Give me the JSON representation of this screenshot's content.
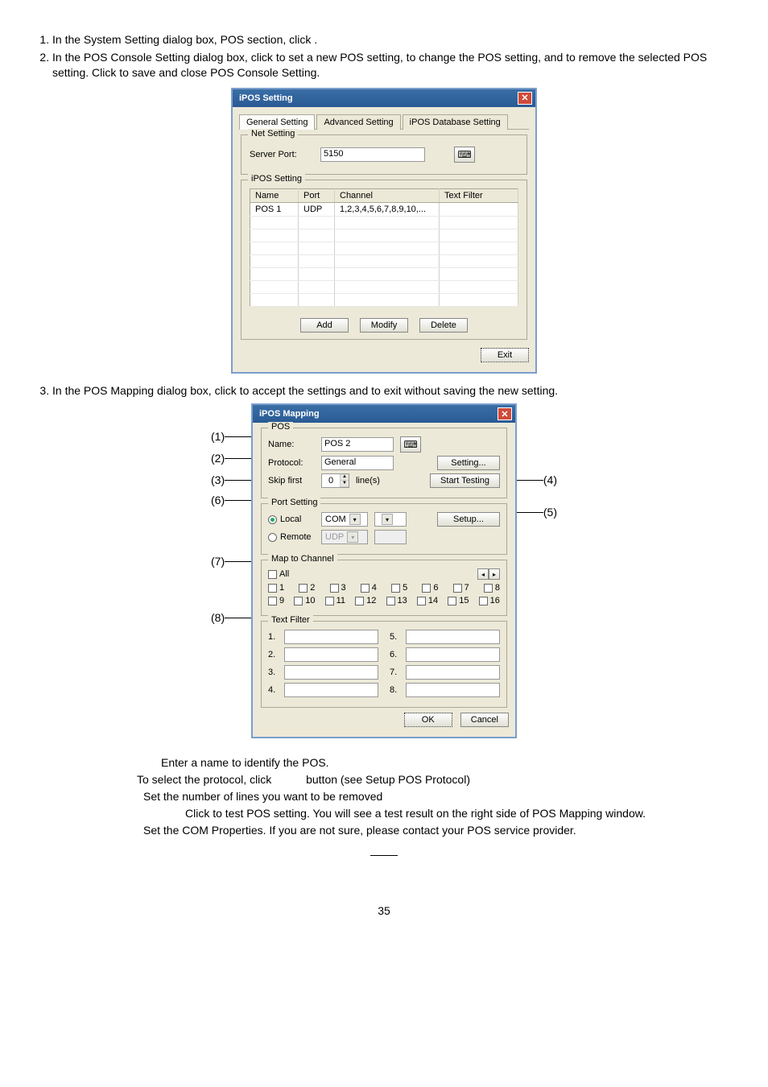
{
  "step1": "In the System Setting dialog box, POS section, click               .",
  "step2": "In the POS Console Setting dialog box, click         to set a new POS setting,            to change the POS setting, and                 to remove the selected POS setting. Click         to save and close POS Console Setting.",
  "step3": "In the POS Mapping dialog box, click         to accept the settings and              to exit without saving the new setting.",
  "ipos_setting": {
    "title": "iPOS Setting",
    "tabs": [
      "General Setting",
      "Advanced Setting",
      "iPOS Database Setting"
    ],
    "net_setting_legend": "Net Setting",
    "server_port_label": "Server Port:",
    "server_port_value": "5150",
    "ipos_setting_legend": "iPOS Setting",
    "columns": [
      "Name",
      "Port",
      "Channel",
      "Text Filter"
    ],
    "row": {
      "name": "POS 1",
      "port": "UDP",
      "channel": "1,2,3,4,5,6,7,8,9,10,...",
      "filter": ""
    },
    "btn_add": "Add",
    "btn_modify": "Modify",
    "btn_delete": "Delete",
    "btn_exit": "Exit"
  },
  "annots": {
    "a1": "(1)",
    "a2": "(2)",
    "a3": "(3)",
    "a4": "(4)",
    "a5": "(5)",
    "a6": "(6)",
    "a7": "(7)",
    "a8": "(8)"
  },
  "ipos_mapping": {
    "title": "iPOS Mapping",
    "pos_legend": "POS",
    "name_label": "Name:",
    "name_value": "POS 2",
    "protocol_label": "Protocol:",
    "protocol_value": "General",
    "btn_setting": "Setting...",
    "skip_label": "Skip first",
    "skip_value": "0",
    "lines_label": "line(s)",
    "btn_start": "Start Testing",
    "port_legend": "Port Setting",
    "local_label": "Local",
    "com_value": "COM",
    "btn_setup": "Setup...",
    "remote_label": "Remote",
    "udp_value": "UDP",
    "map_legend": "Map to Channel",
    "all_label": "All",
    "channels": [
      "1",
      "2",
      "3",
      "4",
      "5",
      "6",
      "7",
      "8",
      "9",
      "10",
      "11",
      "12",
      "13",
      "14",
      "15",
      "16"
    ],
    "filter_legend": "Text Filter",
    "filter_nums_left": [
      "1.",
      "2.",
      "3.",
      "4."
    ],
    "filter_nums_right": [
      "5.",
      "6.",
      "7.",
      "8."
    ],
    "btn_ok": "OK",
    "btn_cancel": "Cancel"
  },
  "desc": {
    "l1": "Enter a name to identify the POS.",
    "l2a": "To select the protocol, click",
    "l2b": "button (see Setup POS Protocol)",
    "l3": "Set the number of lines you want to be removed",
    "l4": "Click to test POS setting. You will see a test result on the right side of POS Mapping window.",
    "l5": "Set the COM Properties. If you are not sure, please contact your POS service provider."
  },
  "page_num": "35"
}
